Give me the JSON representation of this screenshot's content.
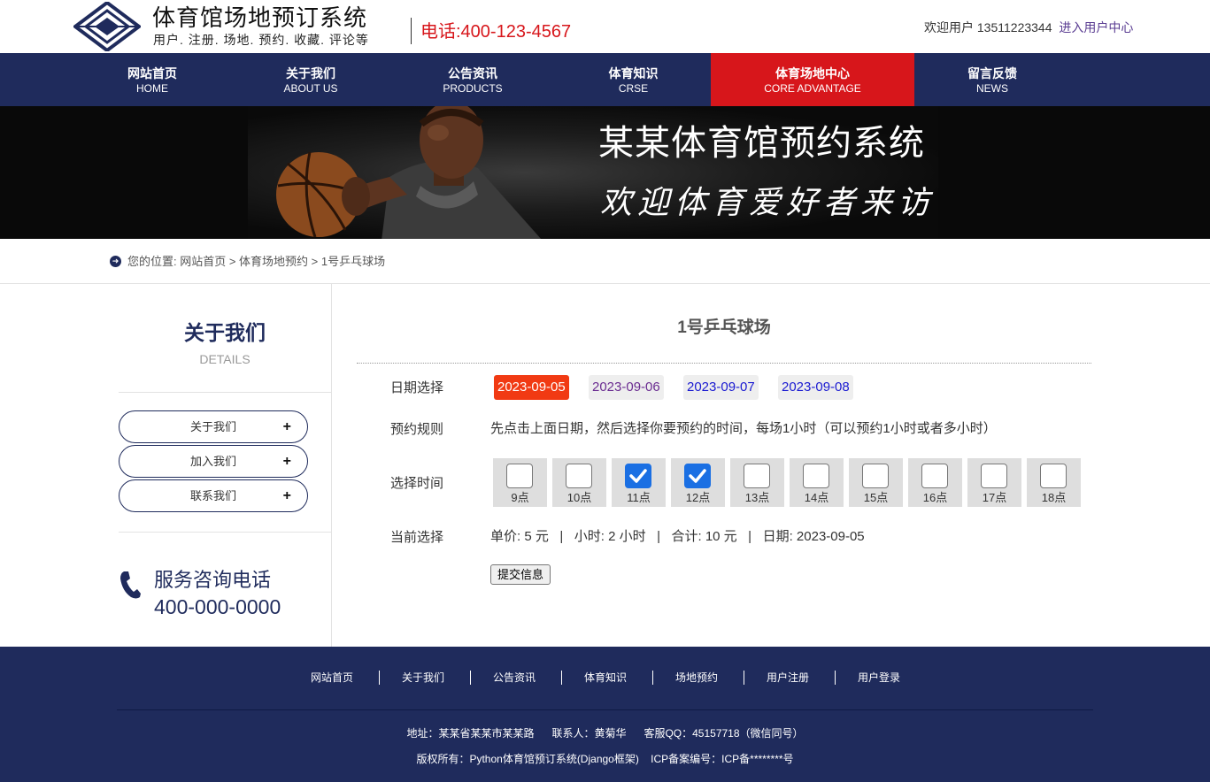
{
  "header": {
    "site_title": "体育馆场地预订系统",
    "site_subtitle": "用户. 注册. 场地. 预约. 收藏. 评论等",
    "phone": "电话:400-123-4567",
    "welcome": "欢迎用户 13511223344",
    "user_center": "进入用户中心"
  },
  "nav": {
    "items": [
      {
        "cn": "网站首页",
        "en": "HOME"
      },
      {
        "cn": "关于我们",
        "en": "ABOUT US"
      },
      {
        "cn": "公告资讯",
        "en": "PRODUCTS"
      },
      {
        "cn": "体育知识",
        "en": "CRSE"
      },
      {
        "cn": "体育场地中心",
        "en": "CORE ADVANTAGE"
      },
      {
        "cn": "留言反馈",
        "en": "NEWS"
      }
    ],
    "active_index": 4,
    "active_color": "#d7161b"
  },
  "banner": {
    "title": "某某体育馆预约系统",
    "subtitle": "欢迎体育爱好者来访"
  },
  "breadcrumb": {
    "text": "您的位置:  网站首页 > 体育场地预约 > 1号乒乓球场"
  },
  "sidebar": {
    "title": "关于我们",
    "subtitle": "DETAILS",
    "items": [
      {
        "label": "关于我们"
      },
      {
        "label": "加入我们"
      },
      {
        "label": "联系我们"
      }
    ],
    "service_label": "服务咨询电话",
    "service_phone": "400-000-0000"
  },
  "main": {
    "title": "1号乒乓球场",
    "date_label": "日期选择",
    "dates": [
      {
        "label": "2023-09-05",
        "color": "#ffffff",
        "active": true
      },
      {
        "label": "2023-09-06",
        "color": "#6a2c91",
        "active": false
      },
      {
        "label": "2023-09-07",
        "color": "#1a1ad1",
        "active": false
      },
      {
        "label": "2023-09-08",
        "color": "#1a1ad1",
        "active": false
      }
    ],
    "rule_label": "预约规则",
    "rule_text": "先点击上面日期，然后选择你要预约的时间，每场1小时（可以预约1小时或者多小时）",
    "time_label": "选择时间",
    "slots": [
      {
        "label": "9点",
        "checked": false
      },
      {
        "label": "10点",
        "checked": false
      },
      {
        "label": "11点",
        "checked": true
      },
      {
        "label": "12点",
        "checked": true
      },
      {
        "label": "13点",
        "checked": false
      },
      {
        "label": "14点",
        "checked": false
      },
      {
        "label": "15点",
        "checked": false
      },
      {
        "label": "16点",
        "checked": false
      },
      {
        "label": "17点",
        "checked": false
      },
      {
        "label": "18点",
        "checked": false
      }
    ],
    "current_label": "当前选择",
    "summary": "单价: 5 元   |   小时: 2 小时   |   合计: 10 元   |   日期: 2023-09-05",
    "submit_label": "提交信息"
  },
  "footer": {
    "links": [
      "网站首页",
      "关于我们",
      "公告资讯",
      "体育知识",
      "场地预约",
      "用户注册",
      "用户登录"
    ],
    "address_line": "地址：某某省某某市某某路      联系人：黄菊华      客服QQ：45157718（微信同号）",
    "copyright_line": "版权所有：Python体育馆预订系统(Django框架)    ICP备案编号：ICP备********号"
  },
  "colors": {
    "brand_navy": "#1f2b5c",
    "accent_red": "#d7161b",
    "date_active": "#f13a13",
    "checkbox_checked": "#1a6fe3"
  },
  "icons": [
    "logo-diamond-icon",
    "arrow-right-circle-icon",
    "plus-icon",
    "phone-icon",
    "check-icon"
  ]
}
